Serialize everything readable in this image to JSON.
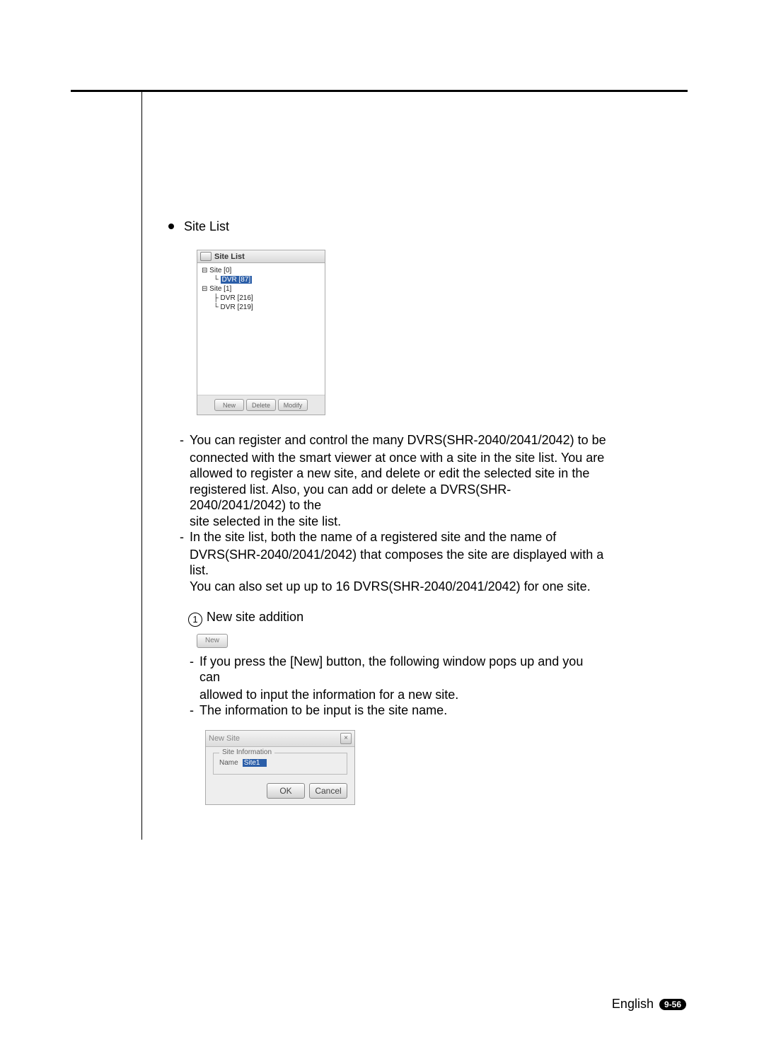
{
  "header": {
    "section_title": "Site List"
  },
  "panel": {
    "title": "Site List",
    "tree": {
      "site0": "Site [0]",
      "dvr87": "DVR [87]",
      "site1": "Site [1]",
      "dvr216": "DVR [216]",
      "dvr219": "DVR [219]"
    },
    "buttons": {
      "new": "New",
      "delete": "Delete",
      "modify": "Modify"
    }
  },
  "paragraphs": {
    "p1a": "You can register and control the many DVRS(SHR-2040/2041/2042) to be",
    "p1b": "connected with the smart viewer at once with a site in the site list. You are",
    "p1c": "allowed to register a new site, and delete or edit the selected site in the",
    "p1d": "registered list. Also, you can add or delete a DVRS(SHR-2040/2041/2042) to the",
    "p1e": "site selected in the site list.",
    "p2a": "In the site list, both the name of a registered site and the name of",
    "p2b": "DVRS(SHR-2040/2041/2042) that composes the site are displayed with a list.",
    "p2c": "You can also set up up to 16 DVRS(SHR-2040/2041/2042) for one site."
  },
  "step": {
    "num": "1",
    "title": "New site addition",
    "btn_label": "New",
    "p1a": "If you press the [New] button, the following window pops up and you can",
    "p1b": "allowed to input the information for a new site.",
    "p2": "The information to be input is the site name."
  },
  "dialog": {
    "title": "New Site",
    "legend": "Site Information",
    "name_label": "Name",
    "name_value": "Site1",
    "ok": "OK",
    "cancel": "Cancel"
  },
  "footer": {
    "language": "English",
    "page": "9-56"
  }
}
